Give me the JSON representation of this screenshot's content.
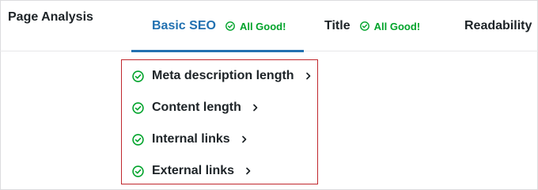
{
  "page": {
    "title": "Page Analysis"
  },
  "tabs": [
    {
      "label": "Basic SEO",
      "status": "All Good!",
      "active": true
    },
    {
      "label": "Title",
      "status": "All Good!",
      "active": false
    },
    {
      "label": "Readability",
      "status": "",
      "active": false
    }
  ],
  "checks": [
    {
      "label": "Meta description length",
      "icon": "check-circle-icon",
      "state": "good"
    },
    {
      "label": "Content length",
      "icon": "check-circle-icon",
      "state": "good"
    },
    {
      "label": "Internal links",
      "icon": "check-circle-icon",
      "state": "good"
    },
    {
      "label": "External links",
      "icon": "check-circle-icon",
      "state": "good"
    }
  ],
  "colors": {
    "accent": "#2271b1",
    "good": "#00a32a",
    "highlight_border": "#c0272d"
  }
}
